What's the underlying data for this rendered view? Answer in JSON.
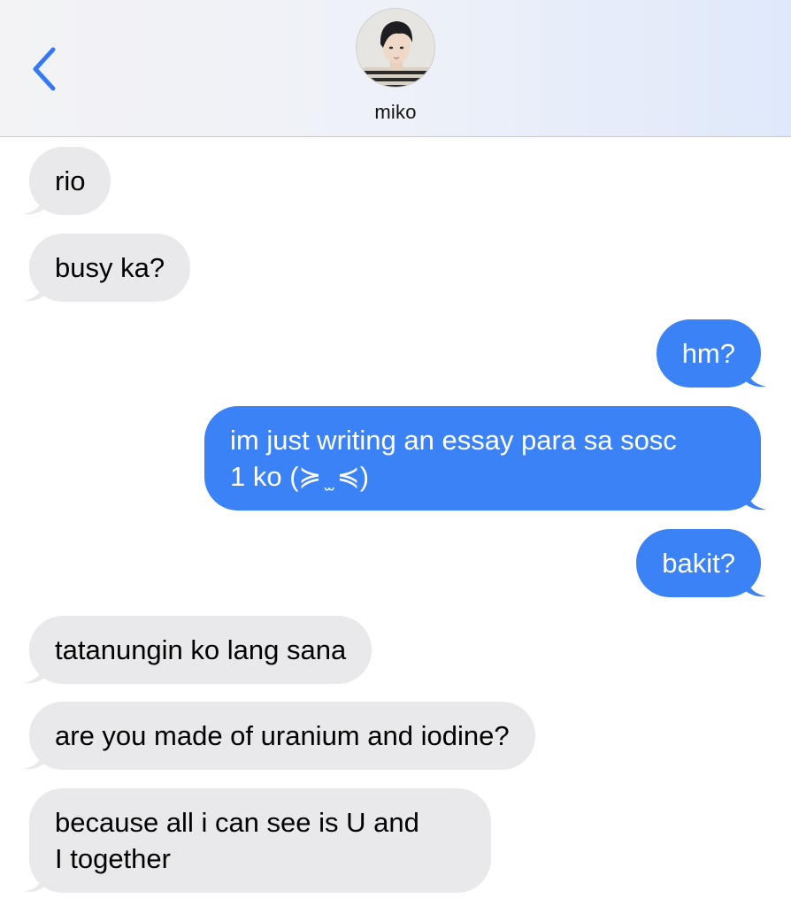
{
  "header": {
    "contact_name": "miko",
    "back_icon": "chevron-left-icon",
    "accent_color": "#3478f6"
  },
  "messages": [
    {
      "direction": "incoming",
      "text": "rio"
    },
    {
      "direction": "incoming",
      "text": "busy ka?"
    },
    {
      "direction": "outgoing",
      "text": "hm?"
    },
    {
      "direction": "outgoing",
      "line1": "im just writing an essay para sa sosc",
      "line2": "1 ko (≽ ̫ ≼)"
    },
    {
      "direction": "outgoing",
      "text": "bakit?"
    },
    {
      "direction": "incoming",
      "text": "tatanungin ko lang sana"
    },
    {
      "direction": "incoming",
      "text": "are you made of uranium and iodine?"
    },
    {
      "direction": "incoming",
      "line1": "because all i can see is U and",
      "line2": "I together"
    }
  ],
  "colors": {
    "incoming_bubble": "#e9e9eb",
    "outgoing_bubble": "#3b82f6"
  }
}
